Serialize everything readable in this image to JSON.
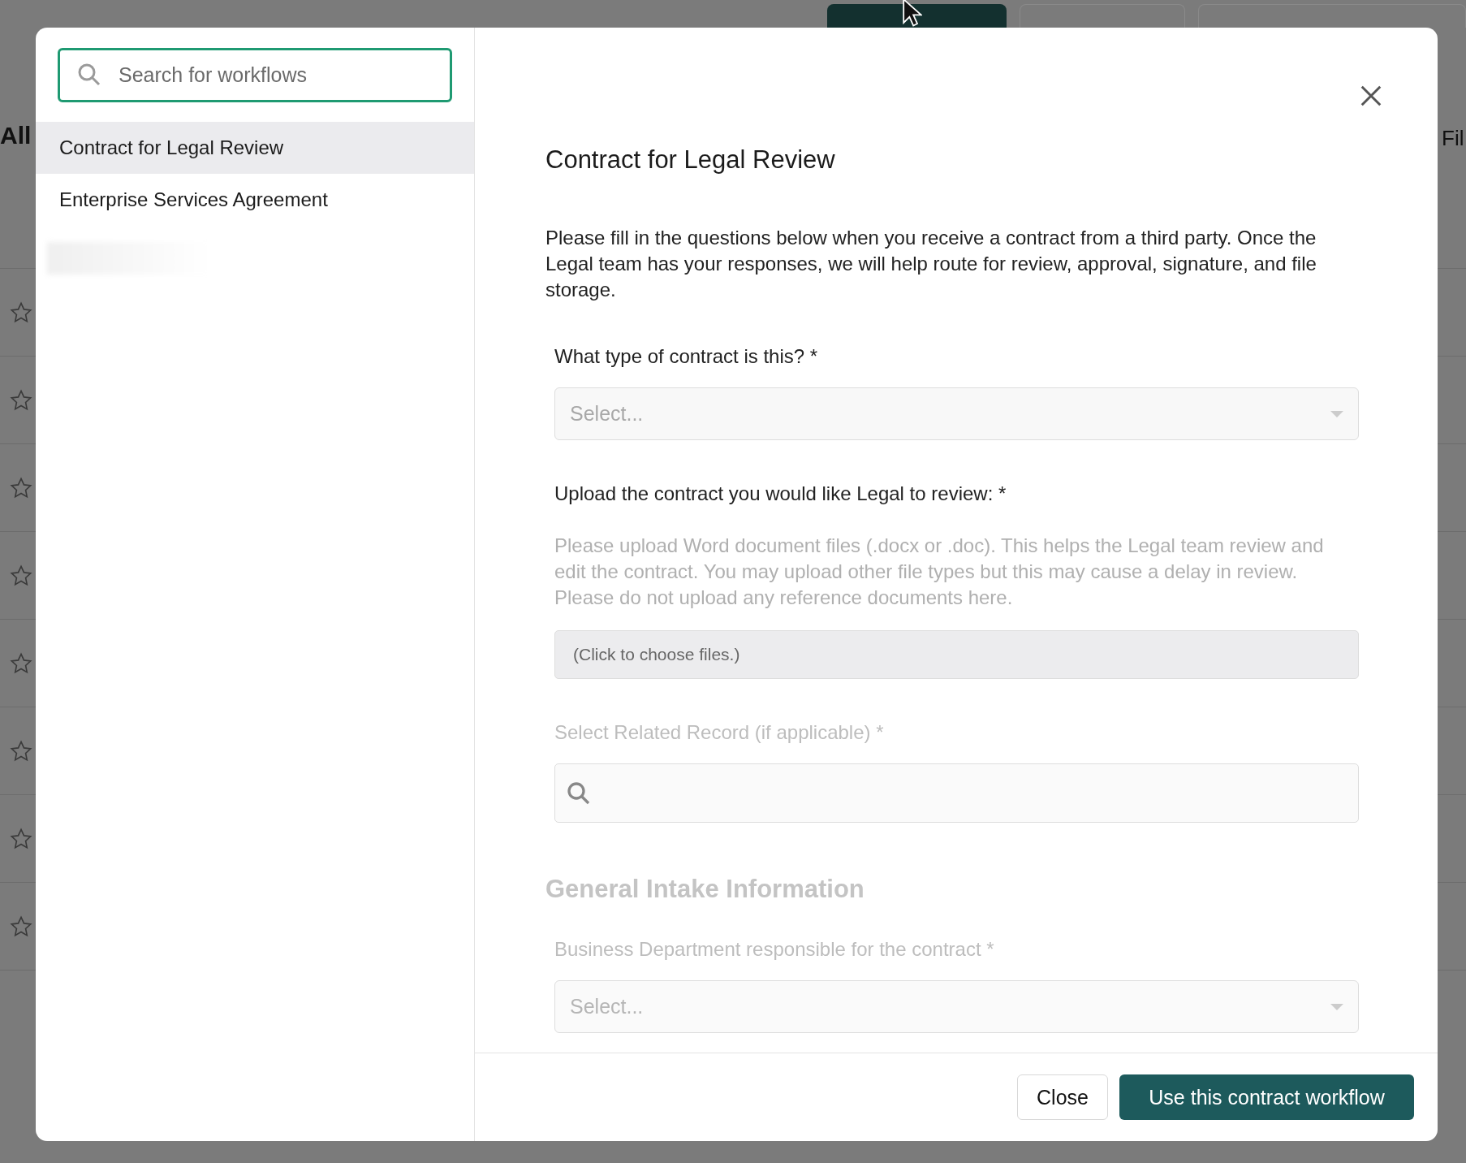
{
  "background": {
    "buttons": [
      {
        "kind": "primary"
      },
      {
        "kind": "secondary"
      },
      {
        "kind": "search"
      }
    ],
    "heading": "All",
    "filter": "Fil",
    "rows": [
      {
        "starred": false
      },
      {
        "starred": false
      },
      {
        "starred": false
      },
      {
        "starred": false
      },
      {
        "starred": false
      },
      {
        "starred": false
      },
      {
        "starred": false
      },
      {
        "starred": false
      }
    ]
  },
  "modal": {
    "search": {
      "placeholder": "Search for workflows"
    },
    "workflows": [
      {
        "label": "Contract for Legal Review",
        "selected": true
      },
      {
        "label": "Enterprise Services Agreement",
        "selected": false
      }
    ],
    "form": {
      "title": "Contract for Legal Review",
      "intro": "Please fill in the questions below when you receive a contract from a third party. Once the Legal team has your responses, we will help route for review, approval, signature, and file storage.",
      "fields": [
        {
          "kind": "select",
          "label": "What type of contract is this? *",
          "placeholder": "Select..."
        },
        {
          "kind": "file",
          "label": "Upload the contract you would like Legal to review: *",
          "help": "Please upload Word document files (.docx or .doc). This helps the Legal team review and edit the contract. You may upload other file types but this may cause a delay in review. Please do not upload any reference documents here.",
          "button": "(Click to choose files.)"
        },
        {
          "kind": "lookup",
          "label": "Select Related Record (if applicable) *"
        },
        {
          "kind": "section",
          "label": "General Intake Information"
        },
        {
          "kind": "select",
          "label": "Business Department responsible for the contract *",
          "placeholder": "Select..."
        }
      ]
    },
    "buttons": [
      {
        "label": "Close",
        "kind": "secondary"
      },
      {
        "label": "Use this contract workflow",
        "kind": "primary"
      }
    ]
  }
}
